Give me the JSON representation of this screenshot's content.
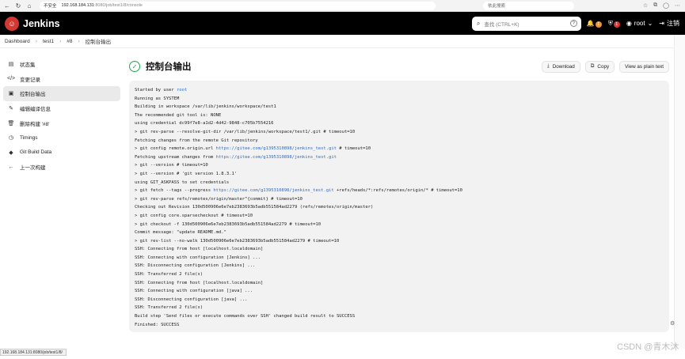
{
  "browser": {
    "insecure_label": "不安全",
    "url_host": "192.168.184.131",
    "url_path": ":8080/job/test1/8/console",
    "search_placeholder": "依此搜索"
  },
  "header": {
    "brand": "Jenkins",
    "search_placeholder": "查找 (CTRL+K)",
    "notifications_count": "1",
    "security_count": "1",
    "user": "root",
    "logout": "注销"
  },
  "breadcrumb": [
    "Dashboard",
    "test1",
    "#8",
    "控制台输出"
  ],
  "sidebar": {
    "items": [
      {
        "label": "状态集",
        "icon": "document-icon"
      },
      {
        "label": "变更记录",
        "icon": "code-icon"
      },
      {
        "label": "控制台输出",
        "icon": "terminal-icon",
        "active": true
      },
      {
        "label": "编辑编译信息",
        "icon": "edit-icon"
      },
      {
        "label": "删除构建 '#8'",
        "icon": "trash-icon"
      },
      {
        "label": "Timings",
        "icon": "clock-icon"
      },
      {
        "label": "Git Build Data",
        "icon": "git-icon"
      },
      {
        "label": "上一次构建",
        "icon": "arrow-left-icon"
      }
    ]
  },
  "main": {
    "title": "控制台输出",
    "actions": {
      "download": "Download",
      "copy": "Copy",
      "plain": "View as plain text"
    }
  },
  "console": {
    "lines": [
      [
        "Started by user ",
        {
          "link": "root"
        }
      ],
      [
        "Running as SYSTEM"
      ],
      [
        "Building in workspace /var/lib/jenkins/workspace/test1"
      ],
      [
        "The recommended git tool is: NONE"
      ],
      [
        "using credential dc99f7e8-a1d2-4d42-9848-c705b7554216"
      ],
      [
        "> git rev-parse --resolve-git-dir /var/lib/jenkins/workspace/test1/.git # timeout=10"
      ],
      [
        "Fetching changes from the remote Git repository"
      ],
      [
        "> git config remote.origin.url ",
        {
          "link": "https://gitee.com/g1395310898/jenkins_test.git"
        },
        " # timeout=10"
      ],
      [
        "Fetching upstream changes from ",
        {
          "link": "https://gitee.com/g1395310898/jenkins_test.git"
        }
      ],
      [
        "> git --version # timeout=10"
      ],
      [
        "> git --version # 'git version 1.8.3.1'"
      ],
      [
        "using GIT_ASKPASS to set credentials"
      ],
      [
        "> git fetch --tags --progress ",
        {
          "link": "https://gitee.com/g1395310898/jenkins_test.git"
        },
        " +refs/heads/*:refs/remotes/origin/* # timeout=10"
      ],
      [
        "> git rev-parse refs/remotes/origin/master^{commit} # timeout=10"
      ],
      [
        "Checking out Revision 130d500906e6e7eb2383693b5adb551584ad2279 (refs/remotes/origin/master)"
      ],
      [
        "> git config core.sparsecheckout # timeout=10"
      ],
      [
        "> git checkout -f 130d500906e6e7eb2383693b5adb551584ad2279 # timeout=10"
      ],
      [
        "Commit message: \"update README.md.\""
      ],
      [
        "> git rev-list --no-walk 130d500906e6e7eb2383693b5adb551584ad2279 # timeout=10"
      ],
      [
        "SSH: Connecting from host [localhost.localdomain]"
      ],
      [
        "SSH: Connecting with configuration [Jenkins] ..."
      ],
      [
        "SSH: Disconnecting configuration [Jenkins] ..."
      ],
      [
        "SSH: Transferred 2 file(s)"
      ],
      [
        "SSH: Connecting from host [localhost.localdomain]"
      ],
      [
        "SSH: Connecting with configuration [java] ..."
      ],
      [
        "SSH: Disconnecting configuration [java] ..."
      ],
      [
        "SSH: Transferred 2 file(s)"
      ],
      [
        "Build step 'Send files or execute commands over SSH' changed build result to SUCCESS"
      ],
      [
        "Finished: SUCCESS"
      ]
    ]
  },
  "statusbar": "192.168.184.131:8080/job/test1/8/",
  "watermark": "CSDN @青木沐"
}
